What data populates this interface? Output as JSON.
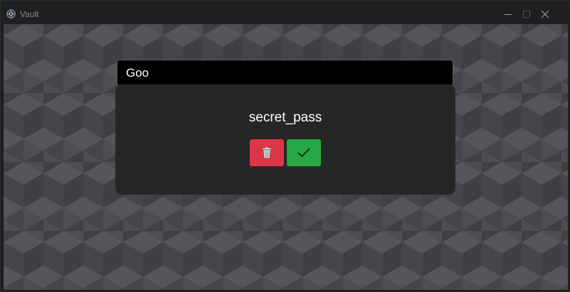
{
  "window": {
    "title": "Vault",
    "icon": "vault-app-icon",
    "controls": [
      "minimize-icon",
      "maximize-icon",
      "close-icon"
    ]
  },
  "search": {
    "value": "Goo"
  },
  "entry": {
    "name": "secret_pass",
    "actions": [
      {
        "name": "delete",
        "icon": "trash-icon",
        "color": "#dc3545"
      },
      {
        "name": "confirm",
        "icon": "checkmark-icon",
        "color": "#28a745"
      }
    ]
  },
  "colors": {
    "background_pattern": "#4a4a4f",
    "card": "#262626",
    "input_bg": "#000000",
    "delete": "#dc3545",
    "confirm": "#28a745"
  }
}
